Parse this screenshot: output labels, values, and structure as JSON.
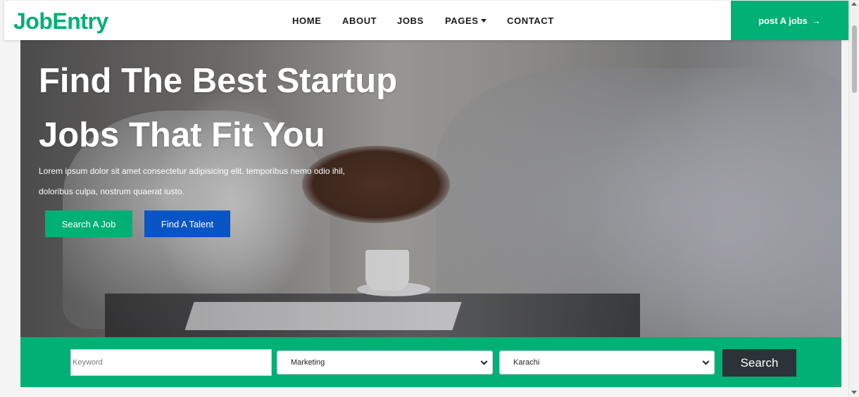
{
  "brand": {
    "name": "JobEntry"
  },
  "nav": {
    "items": [
      {
        "label": "HOME"
      },
      {
        "label": "ABOUT"
      },
      {
        "label": "JOBS"
      },
      {
        "label": "PAGES"
      },
      {
        "label": "CONTACT"
      }
    ],
    "post_button": {
      "label": "post A jobs",
      "icon": "arrow-right-icon"
    }
  },
  "hero": {
    "title_line1": "Find The Best Startup",
    "title_line2": "Jobs That Fit You",
    "text": "Lorem ipsum dolor sit amet consectetur adipisicing elit. temporibus nemo odio ihil, doloribus culpa, nostrum quaerat iusto.",
    "primary_button": "Search A Job",
    "secondary_button": "Find A Talent"
  },
  "search": {
    "keyword_placeholder": "Keyword",
    "category_selected": "Marketing",
    "location_selected": "Karachi",
    "button_label": "Search"
  },
  "colors": {
    "accent": "#00b074",
    "secondary": "#0a55c6",
    "dark_button": "#2b3338"
  }
}
